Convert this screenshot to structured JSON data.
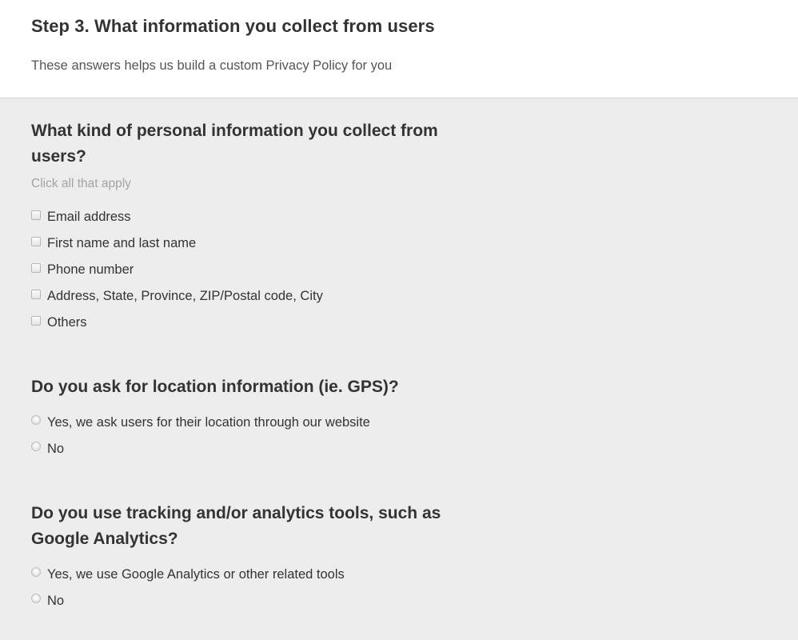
{
  "header": {
    "title": "Step 3. What information you collect from users",
    "subtitle": "These answers helps us build a custom Privacy Policy for you"
  },
  "colors": {
    "header_bg": "#ffffff",
    "body_bg": "#ededed",
    "divider": "#d6d6d6",
    "text": "#333333",
    "hint": "#a3a3a3"
  },
  "questions": [
    {
      "title": "What kind of personal information you collect from users?",
      "hint": "Click all that apply",
      "type": "checkbox",
      "options": [
        {
          "label": "Email address",
          "checked": false
        },
        {
          "label": "First name and last name",
          "checked": false
        },
        {
          "label": "Phone number",
          "checked": false
        },
        {
          "label": "Address, State, Province, ZIP/Postal code, City",
          "checked": false
        },
        {
          "label": "Others",
          "checked": false
        }
      ]
    },
    {
      "title": "Do you ask for location information (ie. GPS)?",
      "type": "radio",
      "options": [
        {
          "label": "Yes, we ask users for their location through our website",
          "checked": false
        },
        {
          "label": "No",
          "checked": false
        }
      ]
    },
    {
      "title": "Do you use tracking and/or analytics tools, such as Google Analytics?",
      "type": "radio",
      "options": [
        {
          "label": "Yes, we use Google Analytics or other related tools",
          "checked": false
        },
        {
          "label": "No",
          "checked": false
        }
      ]
    }
  ]
}
